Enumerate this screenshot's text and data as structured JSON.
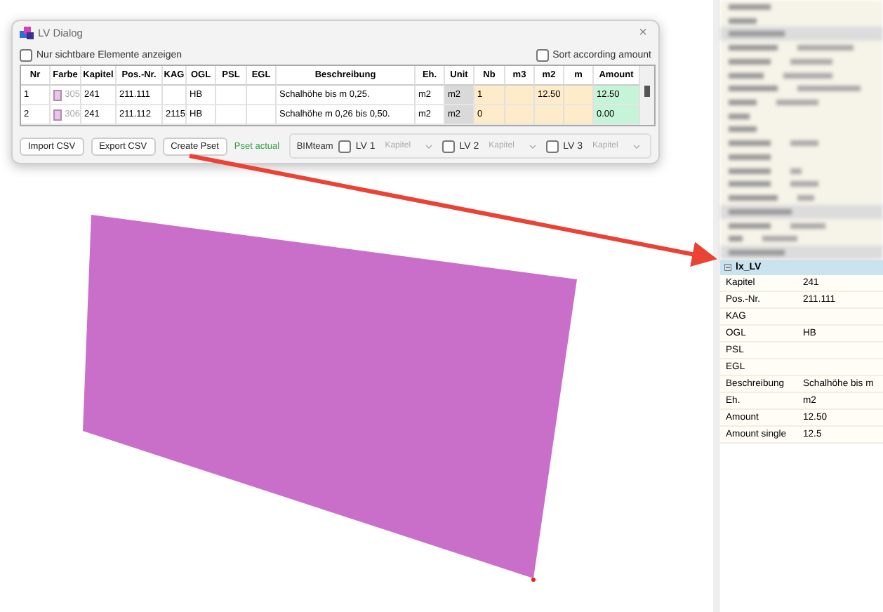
{
  "dialog": {
    "title": "LV Dialog",
    "close": "×",
    "show_visible_only": {
      "label": "Nur sichtbare Elemente anzeigen",
      "checked": false
    },
    "sort_amount": {
      "label": "Sort according amount",
      "checked": false
    },
    "table": {
      "columns": [
        "Nr",
        "Farbe",
        "Kapitel",
        "Pos.-Nr.",
        "KAG",
        "OGL",
        "PSL",
        "EGL",
        "Beschreibung",
        "Eh.",
        "Unit",
        "Nb",
        "m3",
        "m2",
        "m",
        "Amount"
      ],
      "rows": [
        {
          "color": "#e8c6ea",
          "cells": [
            "1",
            "305",
            "241",
            "211.111",
            "",
            "HB",
            "",
            "",
            "Schalhöhe bis m 0,25.",
            "m2",
            "m2",
            "1",
            "",
            "12.50",
            "",
            "12.50"
          ]
        },
        {
          "color": "#e8c6ea",
          "cells": [
            "2",
            "306",
            "241",
            "211.112",
            "2115",
            "HB",
            "",
            "",
            "Schalhöhe m 0,26 bis 0,50.",
            "m2",
            "m2",
            "0",
            "",
            "",
            "",
            "0.00"
          ]
        }
      ]
    },
    "buttons": [
      "Import CSV",
      "Export CSV",
      "Create Pset"
    ],
    "status": "Pset actual",
    "bimteam": {
      "label": "BIMteam",
      "lv": [
        {
          "label": "LV 1",
          "checked": false,
          "placeholder": "Kapitel"
        },
        {
          "label": "LV 2",
          "checked": false,
          "placeholder": "Kapitel"
        },
        {
          "label": "LV 3",
          "checked": false,
          "placeholder": "Kapitel"
        }
      ]
    }
  },
  "properties": {
    "section": "lx_LV",
    "expanded": true,
    "rows": [
      {
        "name": "Kapitel",
        "value": "241"
      },
      {
        "name": "Pos.-Nr.",
        "value": "211.111"
      },
      {
        "name": "KAG",
        "value": ""
      },
      {
        "name": "OGL",
        "value": "HB"
      },
      {
        "name": "PSL",
        "value": ""
      },
      {
        "name": "EGL",
        "value": ""
      },
      {
        "name": "Beschreibung",
        "value": "Schalhöhe bis m"
      },
      {
        "name": "Eh.",
        "value": "m2"
      },
      {
        "name": "Amount",
        "value": "12.50"
      },
      {
        "name": "Amount single",
        "value": "12.5"
      }
    ]
  }
}
